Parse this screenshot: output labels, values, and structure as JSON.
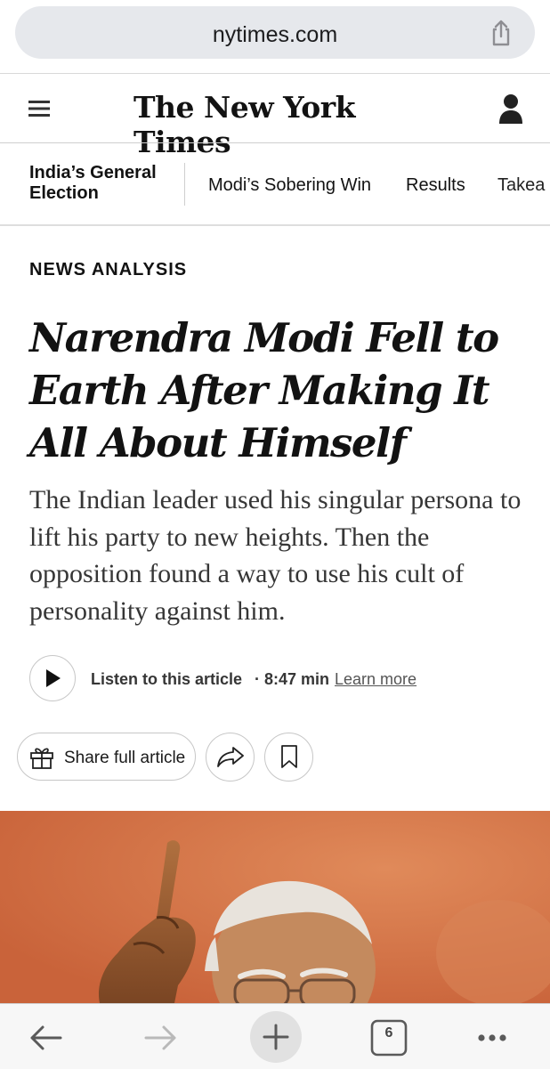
{
  "browser": {
    "url": "nytimes.com",
    "tab_count": "6"
  },
  "masthead": {
    "logo_text": "The New York Times"
  },
  "subnav": {
    "section_title": "India’s General Election",
    "items": [
      {
        "label": "Modi’s Sobering Win"
      },
      {
        "label": "Results"
      },
      {
        "label": "Takea"
      }
    ]
  },
  "article": {
    "kicker": "NEWS ANALYSIS",
    "headline": "Narendra Modi Fell to Earth After Making It All About Himself",
    "summary": "The Indian leader used his singular persona to lift his party to new heights. Then the opposition found a way to use his cult of personality against him.",
    "audio": {
      "label": "Listen to this article",
      "duration": "· 8:47 min",
      "learn_more": "Learn more"
    },
    "actions": {
      "share_full": "Share full article"
    }
  },
  "colors": {
    "hero_bg": "#d26a3c",
    "urlbar_bg": "#e6e8ec"
  }
}
